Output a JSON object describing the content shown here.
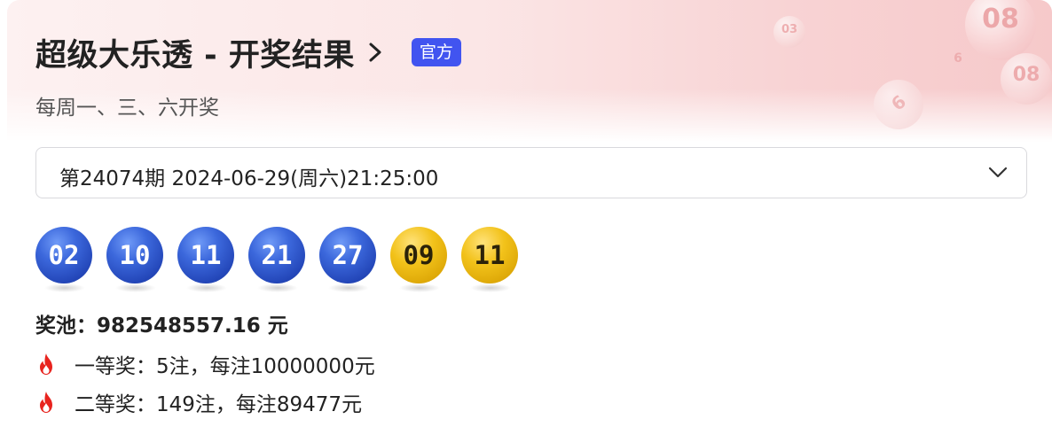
{
  "header": {
    "title": "超级大乐透 - 开奖结果",
    "badge": "官方",
    "subtitle": "每周一、三、六开奖",
    "deco_numbers": [
      "08",
      "08",
      "6",
      "03",
      "6"
    ]
  },
  "draw_select": {
    "value": "第24074期 2024-06-29(周六)21:25:00"
  },
  "balls": {
    "front": [
      "02",
      "10",
      "11",
      "21",
      "27"
    ],
    "back": [
      "09",
      "11"
    ],
    "front_color": "#2f56cc",
    "back_color": "#f0bd13"
  },
  "pool": {
    "label": "奖池：",
    "amount": "982548557.16",
    "unit": " 元"
  },
  "prizes": [
    {
      "text": "一等奖：5注，每注10000000元"
    },
    {
      "text": "二等奖：149注，每注89477元"
    }
  ],
  "colors": {
    "badge": "#4154f0",
    "fire": "#e8231e"
  }
}
